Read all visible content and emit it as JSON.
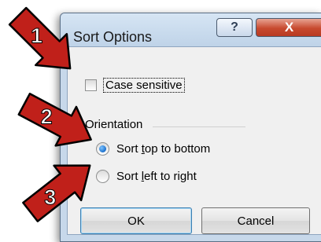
{
  "dialog": {
    "title": "Sort Options",
    "help_label": "?",
    "close_label": "X",
    "case_sensitive_label": "Case sensitive",
    "case_sensitive_checked": false,
    "orientation": {
      "group_label": "Orientation",
      "options": [
        {
          "before": "Sort ",
          "accel": "t",
          "after": "op to bottom",
          "selected": true
        },
        {
          "before": "Sort ",
          "accel": "l",
          "after": "eft to right",
          "selected": false
        }
      ]
    },
    "ok_label": "OK",
    "cancel_label": "Cancel"
  },
  "callouts": [
    {
      "label": "1",
      "color": "#c0201a"
    },
    {
      "label": "2",
      "color": "#c0201a"
    },
    {
      "label": "3",
      "color": "#c0201a"
    }
  ]
}
